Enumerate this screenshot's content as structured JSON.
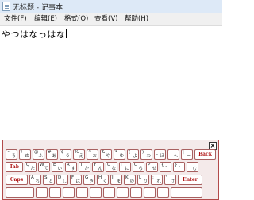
{
  "window": {
    "title": "无标题 - 记事本"
  },
  "menu": [
    "文件(F)",
    "编辑(E)",
    "格式(O)",
    "查看(V)",
    "帮助(H)"
  ],
  "editor": {
    "text": "やつはなっはな"
  },
  "keyboard": {
    "close": "×",
    "rows": [
      [
        {
          "t": "~",
          "k": "ろ"
        },
        {
          "t": "!",
          "k": "ぬ"
        },
        {
          "t": "@",
          "k": "ふ"
        },
        {
          "t": "#",
          "k": "あ"
        },
        {
          "t": "$",
          "k": "う"
        },
        {
          "t": "%",
          "k": "え"
        },
        {
          "t": "^",
          "k": "お"
        },
        {
          "t": "&",
          "k": "や"
        },
        {
          "t": "*",
          "k": "ゆ"
        },
        {
          "t": "(",
          "k": "よ"
        },
        {
          "t": ")",
          "k": "わ"
        },
        {
          "t": "_",
          "k": "ほ"
        },
        {
          "t": "+",
          "k": "へ"
        },
        {
          "t": "|",
          "k": "ー"
        },
        {
          "label": "Back"
        }
      ],
      [
        {
          "label": "Tab"
        },
        {
          "t": "Q",
          "k": "た"
        },
        {
          "t": "W",
          "k": "て"
        },
        {
          "t": "E",
          "k": "い"
        },
        {
          "t": "R",
          "k": "す"
        },
        {
          "t": "T",
          "k": "か"
        },
        {
          "t": "Y",
          "k": "ん"
        },
        {
          "t": "U",
          "k": "な"
        },
        {
          "t": "I",
          "k": "に"
        },
        {
          "t": "O",
          "k": "ら"
        },
        {
          "t": "P",
          "k": "せ"
        },
        {
          "t": "{",
          "k": "゛"
        },
        {
          "t": "}",
          "k": "゜"
        },
        {
          "t": "",
          "k": "む"
        }
      ],
      [
        {
          "label": "Caps"
        },
        {
          "t": "A",
          "k": "ち"
        },
        {
          "t": "S",
          "k": "と"
        },
        {
          "t": "D",
          "k": "し"
        },
        {
          "t": "F",
          "k": "は"
        },
        {
          "t": "G",
          "k": "き"
        },
        {
          "t": "H",
          "k": "く"
        },
        {
          "t": "J",
          "k": "ま"
        },
        {
          "t": "K",
          "k": "の"
        },
        {
          "t": "L",
          "k": "り"
        },
        {
          "t": ":",
          "k": "れ"
        },
        {
          "t": "\"",
          "k": "け"
        },
        {
          "label": "Enter"
        }
      ],
      [
        {
          "label": ""
        },
        {
          "t": "",
          "k": ""
        },
        {
          "t": "",
          "k": ""
        },
        {
          "t": "",
          "k": ""
        },
        {
          "t": "",
          "k": ""
        },
        {
          "t": "",
          "k": ""
        },
        {
          "t": "",
          "k": ""
        },
        {
          "t": "",
          "k": ""
        },
        {
          "t": "",
          "k": ""
        },
        {
          "t": "",
          "k": ""
        },
        {
          "t": "",
          "k": ""
        },
        {
          "label": ""
        }
      ]
    ]
  }
}
